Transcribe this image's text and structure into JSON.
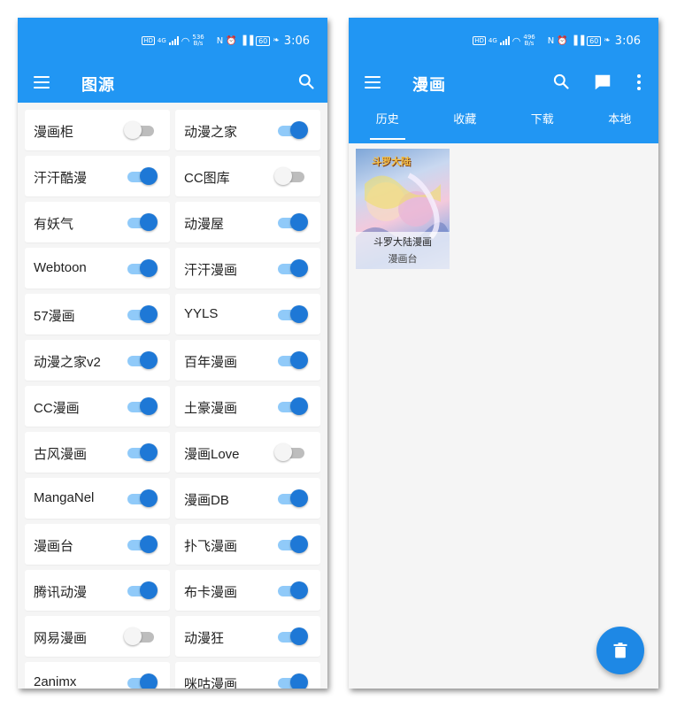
{
  "colors": {
    "primary": "#2196f3",
    "toggle_on": "#1e78d6",
    "toggle_on_track": "#90caf9",
    "toggle_off_track": "#bdbdbd",
    "fab": "#1e88e5"
  },
  "left_screen": {
    "status_bar": {
      "speed_top": "536",
      "speed_unit": "B/s",
      "battery": "60",
      "time": "3:06"
    },
    "title": "图源",
    "sources": [
      {
        "label": "漫画柜",
        "enabled": false
      },
      {
        "label": "动漫之家",
        "enabled": true
      },
      {
        "label": "汗汗酷漫",
        "enabled": true
      },
      {
        "label": "CC图库",
        "enabled": false
      },
      {
        "label": "有妖气",
        "enabled": true
      },
      {
        "label": "动漫屋",
        "enabled": true
      },
      {
        "label": "Webtoon",
        "enabled": true
      },
      {
        "label": "汗汗漫画",
        "enabled": true
      },
      {
        "label": "57漫画",
        "enabled": true
      },
      {
        "label": "YYLS",
        "enabled": true
      },
      {
        "label": "动漫之家v2",
        "enabled": true
      },
      {
        "label": "百年漫画",
        "enabled": true
      },
      {
        "label": "CC漫画",
        "enabled": true
      },
      {
        "label": "土豪漫画",
        "enabled": true
      },
      {
        "label": "古风漫画",
        "enabled": true
      },
      {
        "label": "漫画Love",
        "enabled": false
      },
      {
        "label": "MangaNel",
        "enabled": true
      },
      {
        "label": "漫画DB",
        "enabled": true
      },
      {
        "label": "漫画台",
        "enabled": true
      },
      {
        "label": "扑飞漫画",
        "enabled": true
      },
      {
        "label": "腾讯动漫",
        "enabled": true
      },
      {
        "label": "布卡漫画",
        "enabled": true
      },
      {
        "label": "网易漫画",
        "enabled": false
      },
      {
        "label": "动漫狂",
        "enabled": true
      },
      {
        "label": "2animx",
        "enabled": true
      },
      {
        "label": "咪咕漫画",
        "enabled": true
      }
    ]
  },
  "right_screen": {
    "status_bar": {
      "speed_top": "496",
      "speed_unit": "B/s",
      "battery": "60",
      "time": "3:06"
    },
    "title": "漫画",
    "tabs": [
      {
        "label": "历史",
        "active": true
      },
      {
        "label": "收藏",
        "active": false
      },
      {
        "label": "下载",
        "active": false
      },
      {
        "label": "本地",
        "active": false
      }
    ],
    "comic": {
      "cover_logo": "斗罗大陆",
      "title": "斗罗大陆漫画",
      "source": "漫画台"
    },
    "icons": {
      "search": "search-icon",
      "message": "message-icon",
      "more": "more-vert-icon",
      "fab": "delete-icon"
    }
  }
}
